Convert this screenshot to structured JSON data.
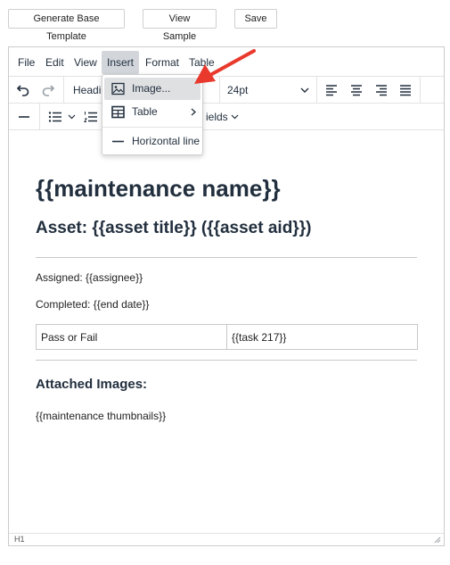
{
  "top_buttons": {
    "generate": "Generate Base Template",
    "view_sample": "View Sample",
    "save": "Save"
  },
  "menubar": {
    "file": "File",
    "edit": "Edit",
    "view": "View",
    "insert": "Insert",
    "format": "Format",
    "table": "Table",
    "active": "Insert"
  },
  "toolbar": {
    "block_format": "Headi",
    "font_size": "24pt",
    "merge_fields": "ields"
  },
  "insert_menu": {
    "image": "Image...",
    "table": "Table",
    "horizontal_line": "Horizontal line",
    "hovered": "Image..."
  },
  "document": {
    "title": "{{maintenance name}}",
    "asset_heading": "Asset: {{asset title}} ({{asset aid}})",
    "assigned": "Assigned: {{assignee}}",
    "completed": "Completed: {{end date}}",
    "table_rows": [
      [
        "Pass or Fail",
        "{{task 217}}"
      ]
    ],
    "attached_heading": "Attached Images:",
    "thumbnails": "{{maintenance thumbnails}}"
  },
  "statusbar": {
    "path": "H1"
  },
  "colors": {
    "annotation_arrow": "#e8392c",
    "menu_active_bg": "#d2d6db",
    "menu_hover_bg": "#dee0e2",
    "border": "#cccccc"
  },
  "icons": {
    "undo": "undo-icon",
    "redo": "redo-icon",
    "align_left": "align-left-icon",
    "align_center": "align-center-icon",
    "align_right": "align-right-icon",
    "align_justify": "align-justify-icon",
    "horizontal_rule": "horizontal-rule-icon",
    "bullet_list": "bullet-list-icon",
    "numbered_list": "numbered-list-icon",
    "image": "image-icon",
    "table": "table-icon",
    "chevron": "chevron-right-icon"
  }
}
